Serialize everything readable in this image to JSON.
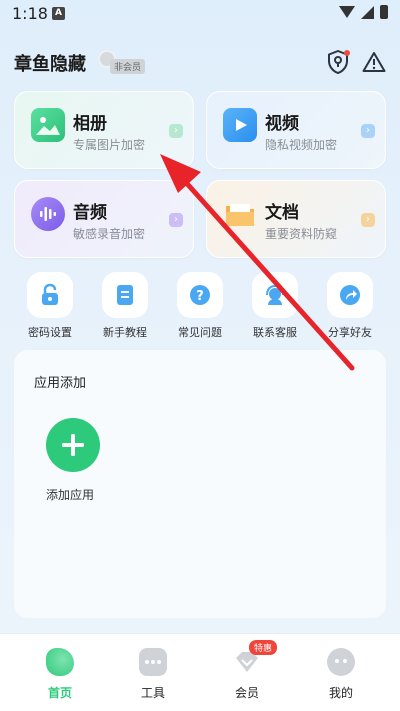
{
  "status": {
    "time": "1:18",
    "notif_letter": "A"
  },
  "header": {
    "title": "章鱼隐藏",
    "member_tag": "非会员"
  },
  "categories": [
    {
      "title": "相册",
      "subtitle": "专属图片加密",
      "color": "#3ccf8e"
    },
    {
      "title": "视频",
      "subtitle": "隐私视频加密",
      "color": "#2d9bf0"
    },
    {
      "title": "音频",
      "subtitle": "敏感录音加密",
      "color": "#8a6cf0"
    },
    {
      "title": "文档",
      "subtitle": "重要资料防窥",
      "color": "#f5a53b"
    }
  ],
  "tools": [
    {
      "label": "密码设置",
      "icon": "lock-icon"
    },
    {
      "label": "新手教程",
      "icon": "document-icon"
    },
    {
      "label": "常见问题",
      "icon": "question-icon"
    },
    {
      "label": "联系客服",
      "icon": "headset-icon"
    },
    {
      "label": "分享好友",
      "icon": "share-icon"
    }
  ],
  "panel": {
    "title": "应用添加",
    "add_label": "添加应用"
  },
  "nav": {
    "items": [
      {
        "label": "首页",
        "icon": "home-icon"
      },
      {
        "label": "工具",
        "icon": "tools-icon"
      },
      {
        "label": "会员",
        "icon": "vip-icon"
      },
      {
        "label": "我的",
        "icon": "profile-icon"
      }
    ],
    "hot_badge": "特惠"
  },
  "colors": {
    "accent": "#2cca7a",
    "arrow": "#e8232a"
  }
}
